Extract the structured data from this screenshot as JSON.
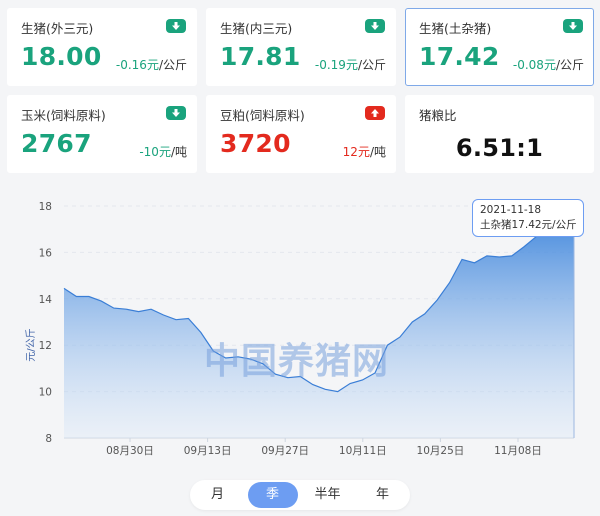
{
  "cards": [
    {
      "name": "生猪(外三元)",
      "price": "18.00",
      "delta": "-0.16元",
      "unit": "/公斤",
      "trend": "down"
    },
    {
      "name": "生猪(内三元)",
      "price": "17.81",
      "delta": "-0.19元",
      "unit": "/公斤",
      "trend": "down"
    },
    {
      "name": "生猪(土杂猪)",
      "price": "17.42",
      "delta": "-0.08元",
      "unit": "/公斤",
      "trend": "down"
    },
    {
      "name": "玉米(饲料原料)",
      "price": "2767",
      "delta": "-10元",
      "unit": "/吨",
      "trend": "down"
    },
    {
      "name": "豆粕(饲料原料)",
      "price": "3720",
      "delta": "12元",
      "unit": "/吨",
      "trend": "up"
    },
    {
      "name": "猪粮比",
      "price": "6.51:1"
    }
  ],
  "chart_data": {
    "type": "area",
    "ylabel": "元/公斤",
    "ylim": [
      8,
      18
    ],
    "yticks": [
      8,
      10,
      12,
      14,
      16,
      18
    ],
    "xticks": [
      "08月30日",
      "09月13日",
      "09月27日",
      "10月11日",
      "10月25日",
      "11月08日"
    ],
    "series": [
      {
        "name": "土杂猪",
        "values": [
          14.45,
          14.1,
          14.1,
          13.9,
          13.6,
          13.55,
          13.45,
          13.55,
          13.3,
          13.1,
          13.15,
          12.55,
          11.75,
          11.45,
          11.5,
          11.4,
          11.2,
          10.75,
          10.6,
          10.65,
          10.3,
          10.1,
          10.0,
          10.35,
          10.5,
          10.8,
          12.0,
          12.35,
          13.0,
          13.35,
          13.95,
          14.7,
          15.7,
          15.55,
          15.85,
          15.8,
          15.85,
          16.25,
          16.7,
          17.0,
          17.2,
          17.42
        ]
      }
    ],
    "grid": true,
    "tooltip": {
      "date": "2021-11-18",
      "label": "土杂猪17.42元/公斤"
    }
  },
  "watermark": "中国养猪网",
  "tabs": [
    {
      "label": "月"
    },
    {
      "label": "季",
      "active": true
    },
    {
      "label": "半年"
    },
    {
      "label": "年"
    }
  ]
}
